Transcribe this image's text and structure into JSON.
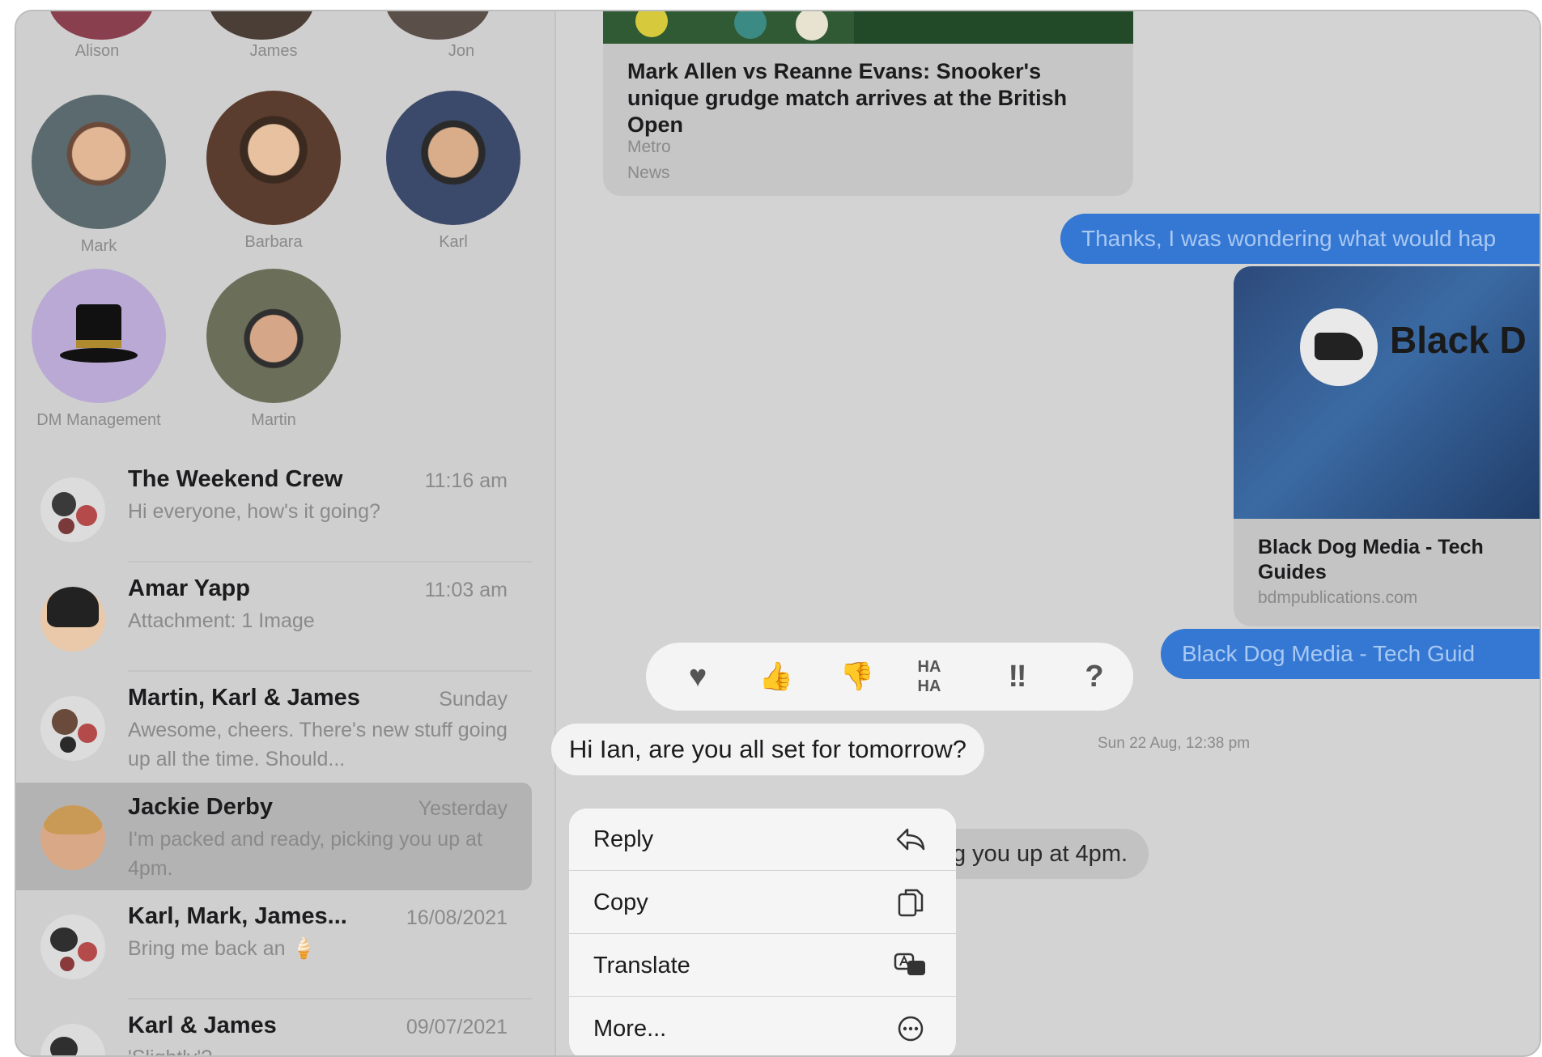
{
  "pinned": [
    {
      "name": "Alison"
    },
    {
      "name": "James"
    },
    {
      "name": "Jon"
    },
    {
      "name": "Mark"
    },
    {
      "name": "Barbara"
    },
    {
      "name": "Karl"
    },
    {
      "name": "DM Management"
    },
    {
      "name": "Martin"
    }
  ],
  "conversations": [
    {
      "title": "The Weekend Crew",
      "time": "11:16 am",
      "preview": "Hi everyone, how's it going?"
    },
    {
      "title": "Amar Yapp",
      "time": "11:03 am",
      "preview": "Attachment: 1 Image"
    },
    {
      "title": "Martin, Karl & James",
      "time": "Sunday",
      "preview": "Awesome, cheers. There's new stuff going up all the time. Should..."
    },
    {
      "title": "Jackie Derby",
      "time": "Yesterday",
      "preview": "I'm packed and ready, picking you up at 4pm."
    },
    {
      "title": "Karl, Mark, James...",
      "time": "16/08/2021",
      "preview": "Bring me back an 🍦"
    },
    {
      "title": "Karl & James",
      "time": "09/07/2021",
      "preview": "'Slightly'?"
    }
  ],
  "chat": {
    "news_card": {
      "title": "Mark Allen vs Reanne Evans: Snooker's unique grudge match arrives at the British Open",
      "source": "Metro",
      "app": "News"
    },
    "sent_thanks": "Thanks, I was wondering what would hap",
    "link_card": {
      "logo_text": "Black D",
      "title": "Black Dog Media - Tech Guides",
      "domain": "bdmpublications.com"
    },
    "sent_link": "Black Dog Media - Tech Guid",
    "selected_message": "Hi Ian, are you all set for tomorrow?",
    "timestamp": "Sun 22 Aug, 12:38 pm",
    "partial_reply": "g you up at 4pm."
  },
  "tapbacks": [
    {
      "name": "heart",
      "glyph": "♥"
    },
    {
      "name": "thumbs-up",
      "glyph": "👍"
    },
    {
      "name": "thumbs-down",
      "glyph": "👎"
    },
    {
      "name": "haha",
      "glyph": "HA HA"
    },
    {
      "name": "emphasize",
      "glyph": "‼"
    },
    {
      "name": "question",
      "glyph": "?"
    }
  ],
  "context_menu": [
    {
      "label": "Reply",
      "icon": "reply-icon"
    },
    {
      "label": "Copy",
      "icon": "copy-icon"
    },
    {
      "label": "Translate",
      "icon": "translate-icon"
    },
    {
      "label": "More...",
      "icon": "more-icon"
    }
  ]
}
